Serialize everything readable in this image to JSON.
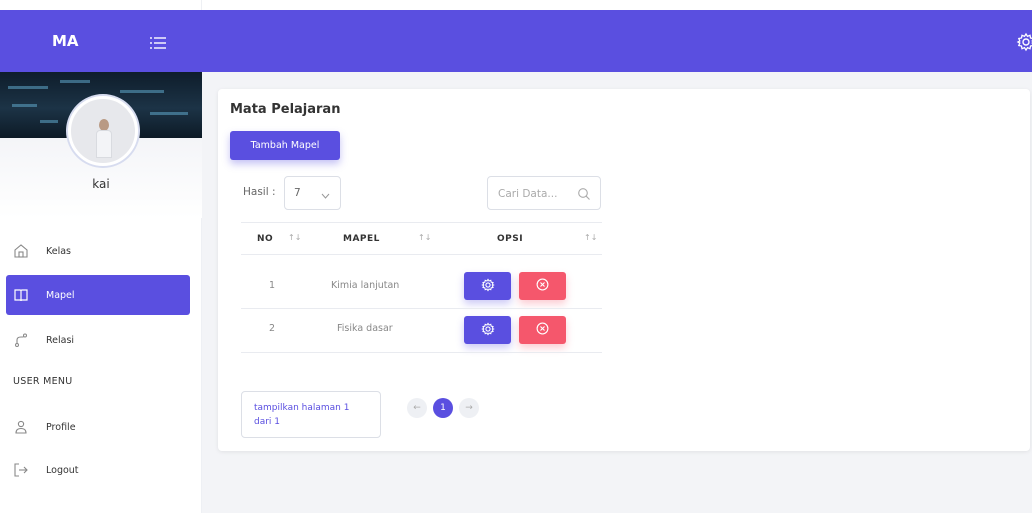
{
  "brand": {
    "name": "MA"
  },
  "user": {
    "name": "kai"
  },
  "nav": {
    "items": [
      {
        "label": "Kelas",
        "icon": "home-icon"
      },
      {
        "label": "Mapel",
        "icon": "book-icon",
        "active": true
      },
      {
        "label": "Relasi",
        "icon": "branch-icon"
      }
    ],
    "section_label": "USER MENU",
    "user_items": [
      {
        "label": "Profile",
        "icon": "user-icon"
      },
      {
        "label": "Logout",
        "icon": "logout-icon"
      }
    ]
  },
  "page": {
    "title": "Mata Pelajaran",
    "add_button": "Tambah Mapel",
    "hasil_label": "Hasil :",
    "hasil_value": "7",
    "search_placeholder": "Cari Data...",
    "columns": [
      "NO",
      "MAPEL",
      "OPSI"
    ],
    "rows": [
      {
        "no": "1",
        "mapel": "Kimia lanjutan"
      },
      {
        "no": "2",
        "mapel": "Fisika dasar"
      }
    ],
    "pagination_info": "tampilkan halaman 1 dari 1",
    "current_page": "1"
  },
  "colors": {
    "primary": "#5a4fe0",
    "danger": "#f5576c"
  }
}
